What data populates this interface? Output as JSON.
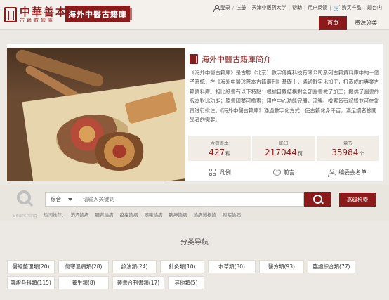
{
  "header": {
    "logo_title": "中華善本",
    "logo_subtitle": "古籍數據庫",
    "brand": "海外中醫古籍庫",
    "top_links": [
      "登录",
      "注册",
      "天津中医药大学",
      "帮助",
      "用户反馈",
      "购买产品",
      "题台内"
    ],
    "nav_tabs": [
      {
        "label": "首页",
        "active": true
      },
      {
        "label": "资源分类",
        "active": false
      }
    ]
  },
  "intro": {
    "title": "海外中醫古籍庫简介",
    "description": "《海外中醫古籍庫》是古聯（北京）數字傳媒科技有限公司系列古籍資料庫中的一個子系統，在《海外中醫珍善本古籍叢刊》基礎上，通過數字化加工，打造成的專業古籍資料庫。相比紙書有以下特點：根據目錄結構對全部圖書做了加工；提供了圖書的版本對比功能；原書印鑒可檢索；用户中心功能完備，流暢、檢索皆有記錄並可在當頁進行批注。《海外中醫古籍庫》通過數字化方式，使古籍化身千百，滿足讀者檢閱學者的需要。",
    "stats": [
      {
        "label": "古籍善本",
        "value": "427",
        "unit": "种"
      },
      {
        "label": "影印",
        "value": "217044",
        "unit": "页"
      },
      {
        "label": "章节",
        "value": "35984",
        "unit": "个"
      }
    ],
    "links": [
      {
        "label": "凡例",
        "icon": "grid-icon"
      },
      {
        "label": "前言",
        "icon": "chat-icon"
      },
      {
        "label": "编委会名单",
        "icon": "person-icon"
      }
    ]
  },
  "search": {
    "logo_word": "Searching",
    "scope": "综合",
    "placeholder": "请输入关键词",
    "advanced_label": "高级检索",
    "hot_label": "热词推荐：",
    "hot_terms": [
      "消渴論病",
      "腰背論病",
      "疫瘟論病",
      "咳嗽論病",
      "脾瘴論病",
      "論病淵根論",
      "瘧疾論病"
    ]
  },
  "categories": {
    "title": "分类导航",
    "items": [
      "醫經整理類(20)",
      "傷寒溫病類(28)",
      "診法類(24)",
      "針灸類(10)",
      "本草類(30)",
      "醫方類(93)",
      "臨證綜合類(77)",
      "臨證各科類(115)",
      "養生類(8)",
      "叢書合刊書類(17)",
      "其他類(5)"
    ]
  }
}
